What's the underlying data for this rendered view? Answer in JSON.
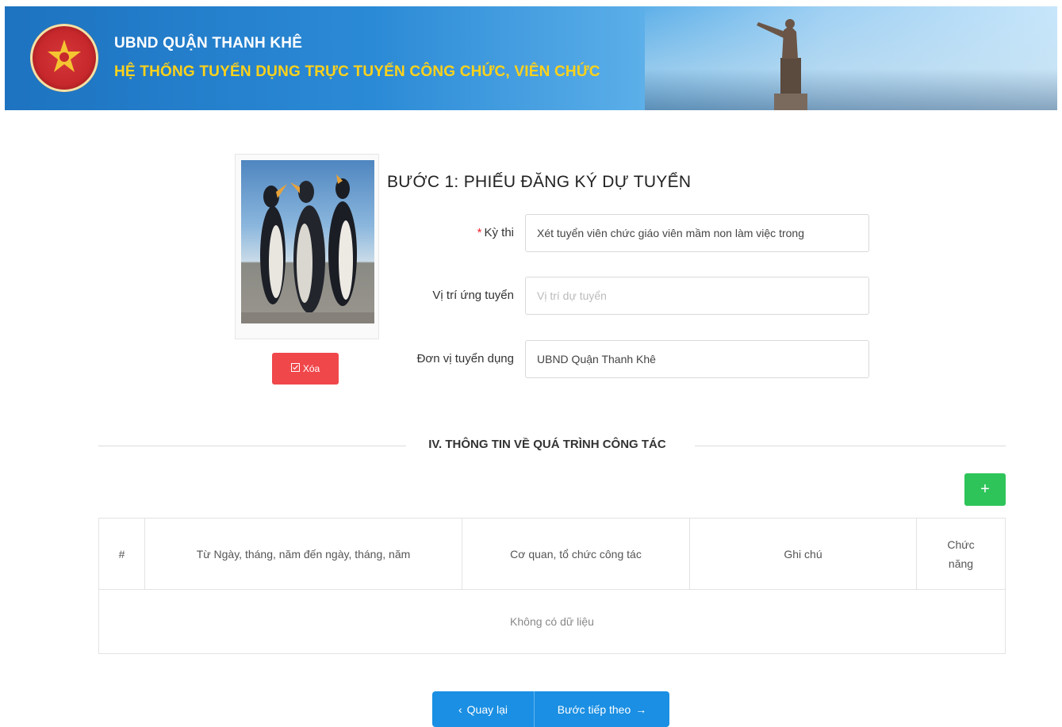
{
  "header": {
    "title_line1": "UBND QUẬN THANH KHÊ",
    "title_line2": "HỆ THỐNG TUYỂN DỤNG TRỰC TUYẾN CÔNG CHỨC, VIÊN CHỨC",
    "colors": {
      "banner_blue": "#1d73c0",
      "title_white": "#ffffff",
      "subtitle_yellow": "#ffd21a"
    }
  },
  "photo": {
    "delete_label": "Xóa",
    "delete_icon": "edit-square-icon",
    "delete_color": "#f0474b"
  },
  "form": {
    "step_title": "BƯỚC 1: PHIẾU ĐĂNG KÝ DỰ TUYỂN",
    "fields": [
      {
        "label": "Kỳ thi",
        "required": true,
        "value": "Xét tuyển viên chức giáo viên mầm non làm việc trong",
        "placeholder": ""
      },
      {
        "label": "Vị trí ứng tuyển",
        "required": false,
        "value": "",
        "placeholder": "Vị trí dự tuyển"
      },
      {
        "label": "Đơn vị tuyển dụng",
        "required": false,
        "value": "UBND Quận Thanh Khê",
        "placeholder": ""
      }
    ]
  },
  "section": {
    "title": "IV. THÔNG TIN VỀ QUÁ TRÌNH CÔNG TÁC",
    "add_label": "+",
    "add_color": "#2ec45a"
  },
  "table": {
    "columns": [
      "#",
      "Từ Ngày, tháng, năm đến ngày, tháng, năm",
      "Cơ quan, tổ chức công tác",
      "Ghi chú",
      "Chức năng"
    ],
    "empty_text": "Không có dữ liệu"
  },
  "nav": {
    "back_label": "Quay lại",
    "back_icon": "chevron-left-icon",
    "next_label": "Bước tiếp theo",
    "next_icon": "arrow-right-icon",
    "color": "#1a8fe3"
  }
}
